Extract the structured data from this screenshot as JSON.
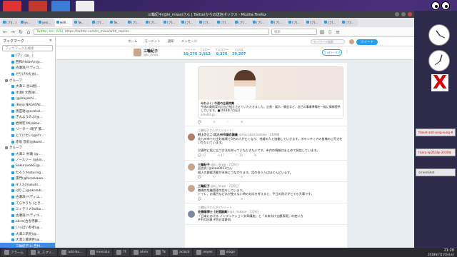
{
  "window": {
    "title": "三輪紀子(@ki_miwa)さん | Twitterからの送信ボックス - Mozilla Firefox",
    "tabs": [
      "(プ)(...)",
      "ye...",
      "yes/...",
      "新規...",
      "Tw...",
      "(プ)...",
      "Tw...",
      "(プ)...",
      "(プ)...",
      "(プ)...",
      "(プ)...",
      "(プ)...",
      "(プ)...",
      "(プ)...",
      "(プ)...",
      "(プ)...",
      "(プ)...",
      "(プ)...",
      "(プ)...",
      "(プ)..."
    ],
    "url_security": "Twitter, Inc. (US)",
    "url": "https://twitter.com/ki_miwa/with_replies",
    "search_placeholder": "検索"
  },
  "sidebar": {
    "title": "ブックマーク",
    "close": "×",
    "search_placeholder": "ブックマークを検索",
    "items": [
      {
        "label": "(プ)...(@...)",
        "folder": false
      },
      {
        "label": "西和/Hsibe\\n(@...",
        "folder": false
      },
      {
        "label": "古瀬浪/ベディユ...",
        "folder": false
      },
      {
        "label": "せりげわたお(...",
        "folder": false
      },
      {
        "label": "グループ",
        "folder": true
      },
      {
        "label": "大澤ミ 谷山智(...",
        "folder": false
      },
      {
        "label": "水澤Ⅱ 大西洋(...",
        "folder": false
      },
      {
        "label": "(@ihayashi...",
        "folder": false
      },
      {
        "label": "(Kenji NAGATAE...",
        "folder": false
      },
      {
        "label": "黒田達(@orahal...",
        "folder": false
      },
      {
        "label": "ぎんようのぶ(@...",
        "folder": false
      },
      {
        "label": "岩崎宏 Miyakoe...",
        "folder": false
      },
      {
        "label": "リーター (竜子 篤...",
        "folder": false
      },
      {
        "label": "とてにたい(@sYr...",
        "folder": false
      },
      {
        "label": "赤坂 音前(@kwat...",
        "folder": false
      },
      {
        "label": "グループ",
        "folder": true
      },
      {
        "label": "大澤ミ 村瀬 (@...",
        "folder": false
      },
      {
        "label": "ノースジー (@kin...",
        "folder": false
      },
      {
        "label": "SakuravolkE(@...",
        "folder": false
      },
      {
        "label": "たろう featuring...",
        "folder": false
      },
      {
        "label": "雷門(@hiroskawa...",
        "folder": false
      },
      {
        "label": "Hリス(mukuhl...",
        "folder": false
      },
      {
        "label": "はりこ(@akosub...",
        "folder": false
      },
      {
        "label": "古瀬浪(ベディユ...",
        "folder": false
      },
      {
        "label": "てらやうち (とき...",
        "folder": false
      },
      {
        "label": "ミィテリメ(toiko...",
        "folder": false
      },
      {
        "label": "古瀬浪(ベディユ...",
        "folder": false
      },
      {
        "label": "akira(古舎寺藤...",
        "folder": false
      },
      {
        "label": "いっぽい参考(@...",
        "folder": false
      },
      {
        "label": "大澤ミ新見(@...",
        "folder": false
      },
      {
        "label": "大澤ミ藤清世(@...",
        "folder": false
      },
      {
        "label": "三輪紀子(ki 西村...",
        "folder": false
      },
      {
        "label": "伊藤(とれたパ...",
        "folder": false
      },
      {
        "label": "橋本 元(@moto...",
        "folder": false
      }
    ],
    "selected_index": 31
  },
  "twitter_nav": {
    "home": "ホーム",
    "moments": "モーメント",
    "notifications": "通知",
    "messages": "メッセージ",
    "search_placeholder": "キーワード検索",
    "tweet_button": "ツイート"
  },
  "profile": {
    "name": "三輪紀子",
    "handle": "@ki_miwa",
    "stats": [
      {
        "label": "ツイート",
        "value": "19,276"
      },
      {
        "label": "フォロー",
        "value": "2,912"
      },
      {
        "label": "フォロワー",
        "value": "8,326"
      },
      {
        "label": "いいね",
        "value": "29,207"
      }
    ],
    "follow_button": "フォローする"
  },
  "tweets": [
    {
      "rt_note": "",
      "author": "",
      "meta": "",
      "text": "",
      "card_title": "みわふく: 今週の企画特集",
      "card_text": "今週の美術案内で自己紹介させていただきました。企画・展示・開会など、自己の事業準備を一般に情報提供しています。■2018年7月(日)",
      "card_domain": "ameblo.jp",
      "counts": [
        "",
        "",
        "",
        ""
      ]
    },
    {
      "rt_note": "三輪紀子さんがリツイート",
      "author": "村上さとこ/北九州市議会議員",
      "meta": "@murakamisatoko · 21時間",
      "text": "北九州市でも土砂崩壊で3名の人が亡くなり、地域の人と協働していきます。ボランティアの皆様のご尽力をいただいています。\n\n災害時に役に立つ方法を知っていただきたいです。市内の情報はまとめて発信しています。",
      "card_title": "",
      "card_text": "",
      "card_domain": "",
      "counts": [
        "11",
        "47",
        "35",
        ""
      ]
    },
    {
      "rt_note": "",
      "author": "三輪紀子",
      "meta": "@ki_miwa · 7月9日",
      "text": "返信先: @kiwa0013さん\n個人の救援活動が未来につながります。話の合う人はほとんどいます。",
      "card_title": "",
      "card_text": "",
      "card_domain": "",
      "counts": [
        "",
        "",
        "",
        ""
      ]
    },
    {
      "rt_note": "",
      "author": "三輪紀子",
      "meta": "@ki_miwa · 7月9日",
      "text": "職場の危機管理の話をしています。\nトイレ、お風呂など水が使えない時の対応を考えると、平日の防災がとても大事です。",
      "card_title": "",
      "card_text": "",
      "card_domain": "",
      "counts": [
        "",
        "",
        "",
        ""
      ]
    },
    {
      "rt_note": "三輪紀子さんがリツイート",
      "author": "佐藤議博士 (支援議員)",
      "meta": "@h_hakase · 7月9日",
      "text": "「日本における ノンフィクション文章講座」と「未来向け全額表現」の使い方\n#中の記事 #西日本豪雨",
      "card_title": "",
      "card_text": "",
      "card_domain": "",
      "counts": [
        "",
        "",
        "",
        ""
      ]
    }
  ],
  "right_panel": {
    "items": [
      "fdeset-add-song-vung-#",
      "tisary-ep2618p-2018年",
      "screenShot"
    ]
  },
  "taskbar": {
    "items": [
      "アラーム",
      "あ_スクリ...",
      "add-bu...",
      "momatu",
      "Tt",
      "ahmr",
      "Tk",
      "aclock",
      "xeyes",
      "xlogo"
    ],
    "clock_time": "21:20",
    "clock_date": "2018年7月10日(火)"
  },
  "colors": {
    "twitter_blue": "#1da1f2",
    "selected_bookmark": "#3d8ee8",
    "desktop_bg": "#3a2a6a"
  }
}
